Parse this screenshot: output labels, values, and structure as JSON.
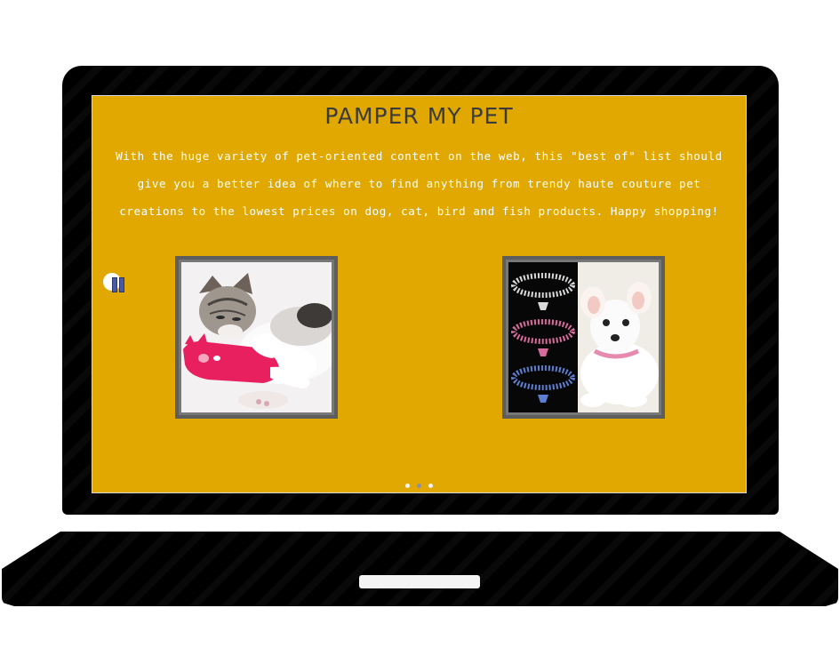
{
  "page": {
    "title": "PAMPER MY PET",
    "intro": "With the huge variety of pet-oriented content on the web, this \"best of\" list should give you a better idea of where to find anything from trendy haute couture pet creations to the lowest prices on dog, cat, bird and fish products. Happy shopping!",
    "background_color": "#e0a800"
  },
  "slideshow": {
    "pause_icon": "pause-icon",
    "images": [
      {
        "name": "cat-with-toy-photo"
      },
      {
        "name": "dog-with-collars-photo"
      }
    ],
    "dots": 3,
    "active_dot": 2
  }
}
